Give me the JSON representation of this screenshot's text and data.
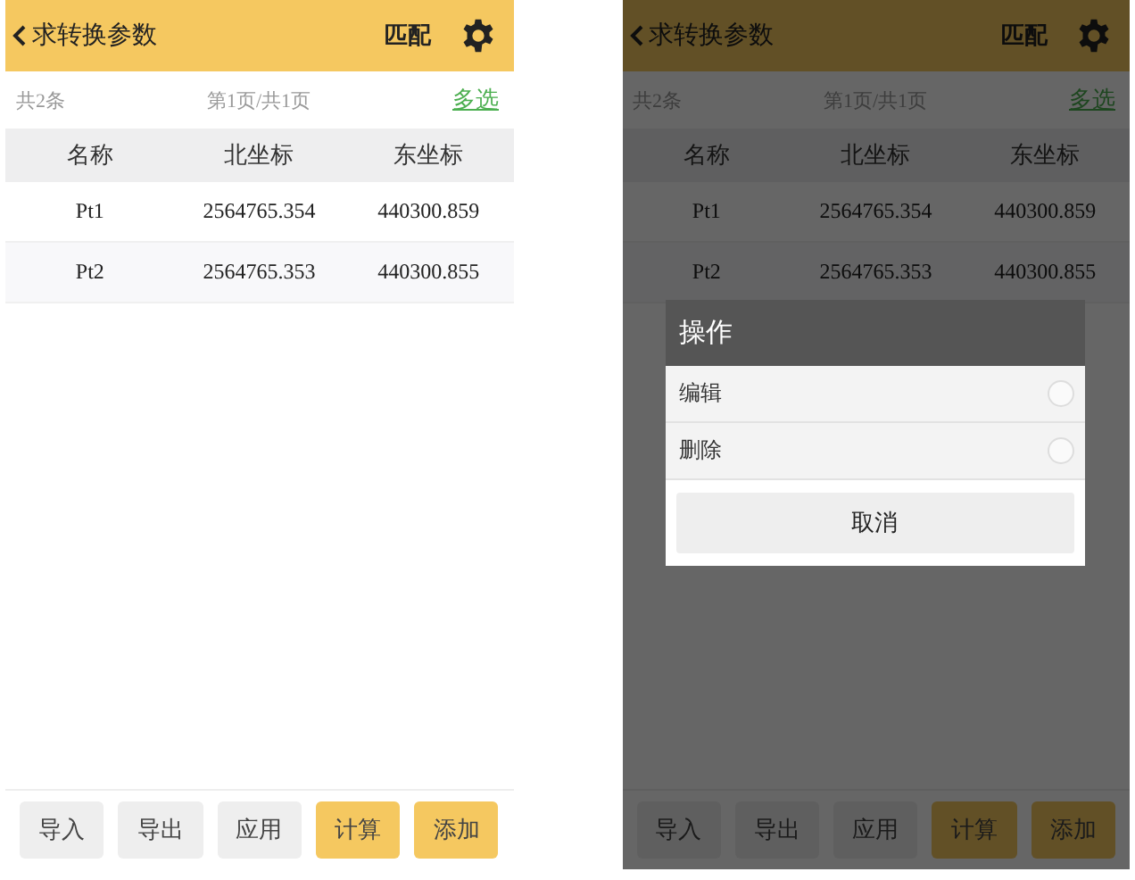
{
  "screens": [
    {
      "title": "求转换参数",
      "match": "匹配",
      "count": "共2条",
      "page": "第1页/共1页",
      "multi": "多选",
      "columns": [
        "名称",
        "北坐标",
        "东坐标"
      ],
      "rows": [
        [
          "Pt1",
          "2564765.354",
          "440300.859"
        ],
        [
          "Pt2",
          "2564765.353",
          "440300.855"
        ]
      ],
      "buttons": [
        {
          "label": "导入",
          "kind": "secondary"
        },
        {
          "label": "导出",
          "kind": "secondary"
        },
        {
          "label": "应用",
          "kind": "secondary"
        },
        {
          "label": "计算",
          "kind": "primary"
        },
        {
          "label": "添加",
          "kind": "primary"
        }
      ]
    },
    {
      "title": "求转换参数",
      "match": "匹配",
      "count": "共2条",
      "page": "第1页/共1页",
      "multi": "多选",
      "columns": [
        "名称",
        "北坐标",
        "东坐标"
      ],
      "rows": [
        [
          "Pt1",
          "2564765.354",
          "440300.859"
        ],
        [
          "Pt2",
          "2564765.353",
          "440300.855"
        ]
      ],
      "buttons": [
        {
          "label": "导入",
          "kind": "secondary"
        },
        {
          "label": "导出",
          "kind": "secondary"
        },
        {
          "label": "应用",
          "kind": "secondary"
        },
        {
          "label": "计算",
          "kind": "primary"
        },
        {
          "label": "添加",
          "kind": "primary"
        }
      ],
      "dialog": {
        "title": "操作",
        "options": [
          {
            "label": "编辑",
            "selected": false
          },
          {
            "label": "删除",
            "selected": false
          }
        ],
        "cancel": "取消"
      }
    }
  ]
}
